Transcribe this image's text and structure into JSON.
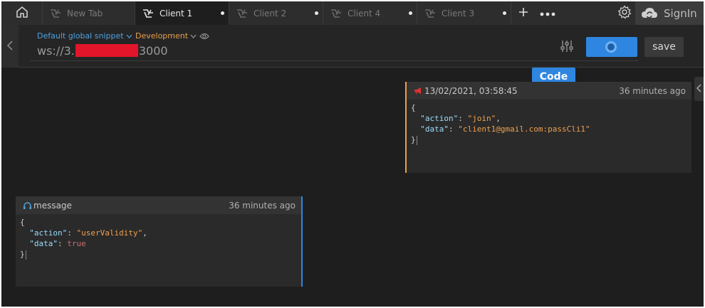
{
  "tabs": [
    {
      "label": "New Tab",
      "active": false,
      "unsaved": false
    },
    {
      "label": "Client 1",
      "active": true,
      "unsaved": true
    },
    {
      "label": "Client 2",
      "active": false,
      "unsaved": true
    },
    {
      "label": "Client 4",
      "active": false,
      "unsaved": true
    },
    {
      "label": "Client 3",
      "active": false,
      "unsaved": true
    }
  ],
  "toolbar": {
    "signin_label": "SignIn"
  },
  "request": {
    "snippet_label": "Default global snippet",
    "environment_label": "Development",
    "url_prefix": "ws://3.",
    "url_suffix": "3000",
    "save_label": "save",
    "connected": true
  },
  "panel": {
    "code_label": "Code"
  },
  "messages": {
    "sent": {
      "timestamp": "13/02/2021, 03:58:45",
      "age": "36 minutes ago",
      "action_key": "\"action\"",
      "action_value": "\"join\"",
      "data_key": "\"data\"",
      "data_value": "\"client1@gmail.com:passCli1\""
    },
    "received": {
      "title": "message",
      "age": "36 minutes ago",
      "action_key": "\"action\"",
      "action_value": "\"userValidity\"",
      "data_key": "\"data\"",
      "data_value": "true"
    }
  },
  "colors": {
    "accent": "#2f86e0",
    "sent_border": "#e8a04a",
    "redaction": "#e3152a"
  }
}
